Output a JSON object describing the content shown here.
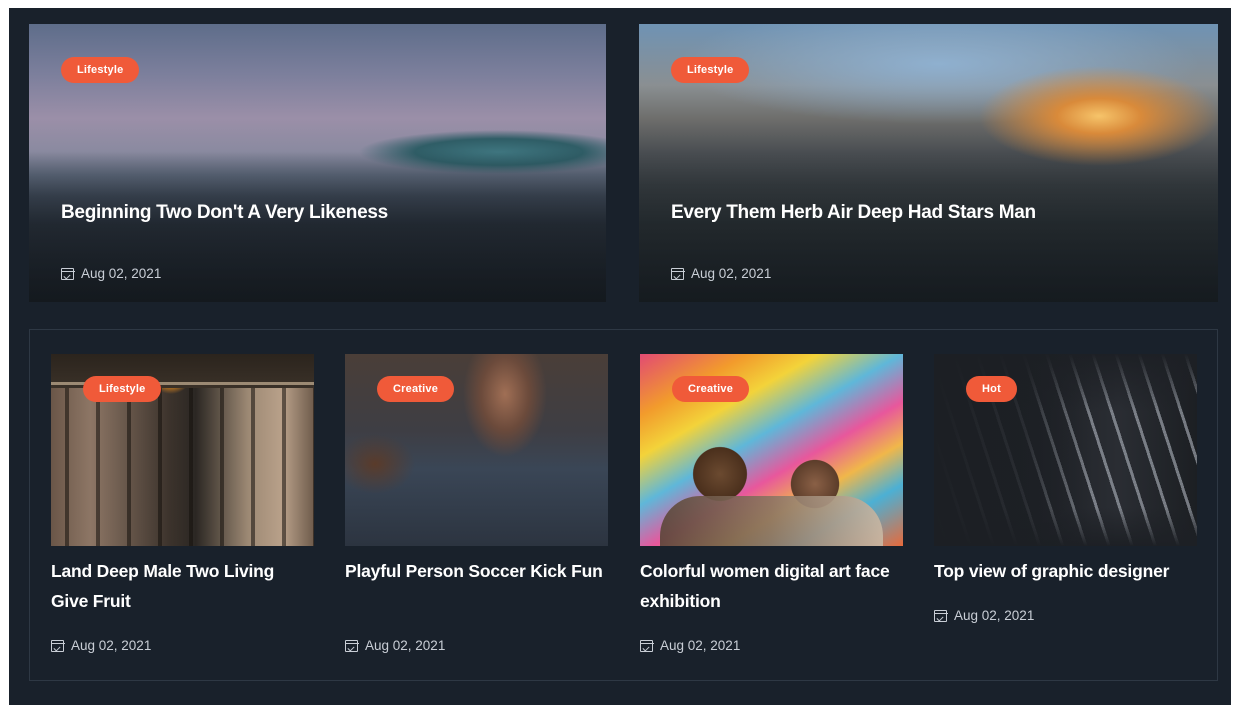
{
  "featured": [
    {
      "category": "Lifestyle",
      "title": "Beginning Two Don't A Very Likeness",
      "date": "Aug 02, 2021"
    },
    {
      "category": "Lifestyle",
      "title": "Every Them Herb Air Deep Had Stars Man",
      "date": "Aug 02, 2021"
    }
  ],
  "posts": [
    {
      "category": "Lifestyle",
      "title": "Land Deep Male Two Living Give Fruit",
      "date": "Aug 02, 2021"
    },
    {
      "category": "Creative",
      "title": "Playful Person Soccer Kick Fun",
      "date": "Aug 02, 2021"
    },
    {
      "category": "Creative",
      "title": "Colorful women digital art face exhibition",
      "date": "Aug 02, 2021"
    },
    {
      "category": "Hot",
      "title": "Top view of graphic designer",
      "date": "Aug 02, 2021"
    }
  ],
  "colors": {
    "badge": "#f05a39",
    "background": "#19212b"
  }
}
